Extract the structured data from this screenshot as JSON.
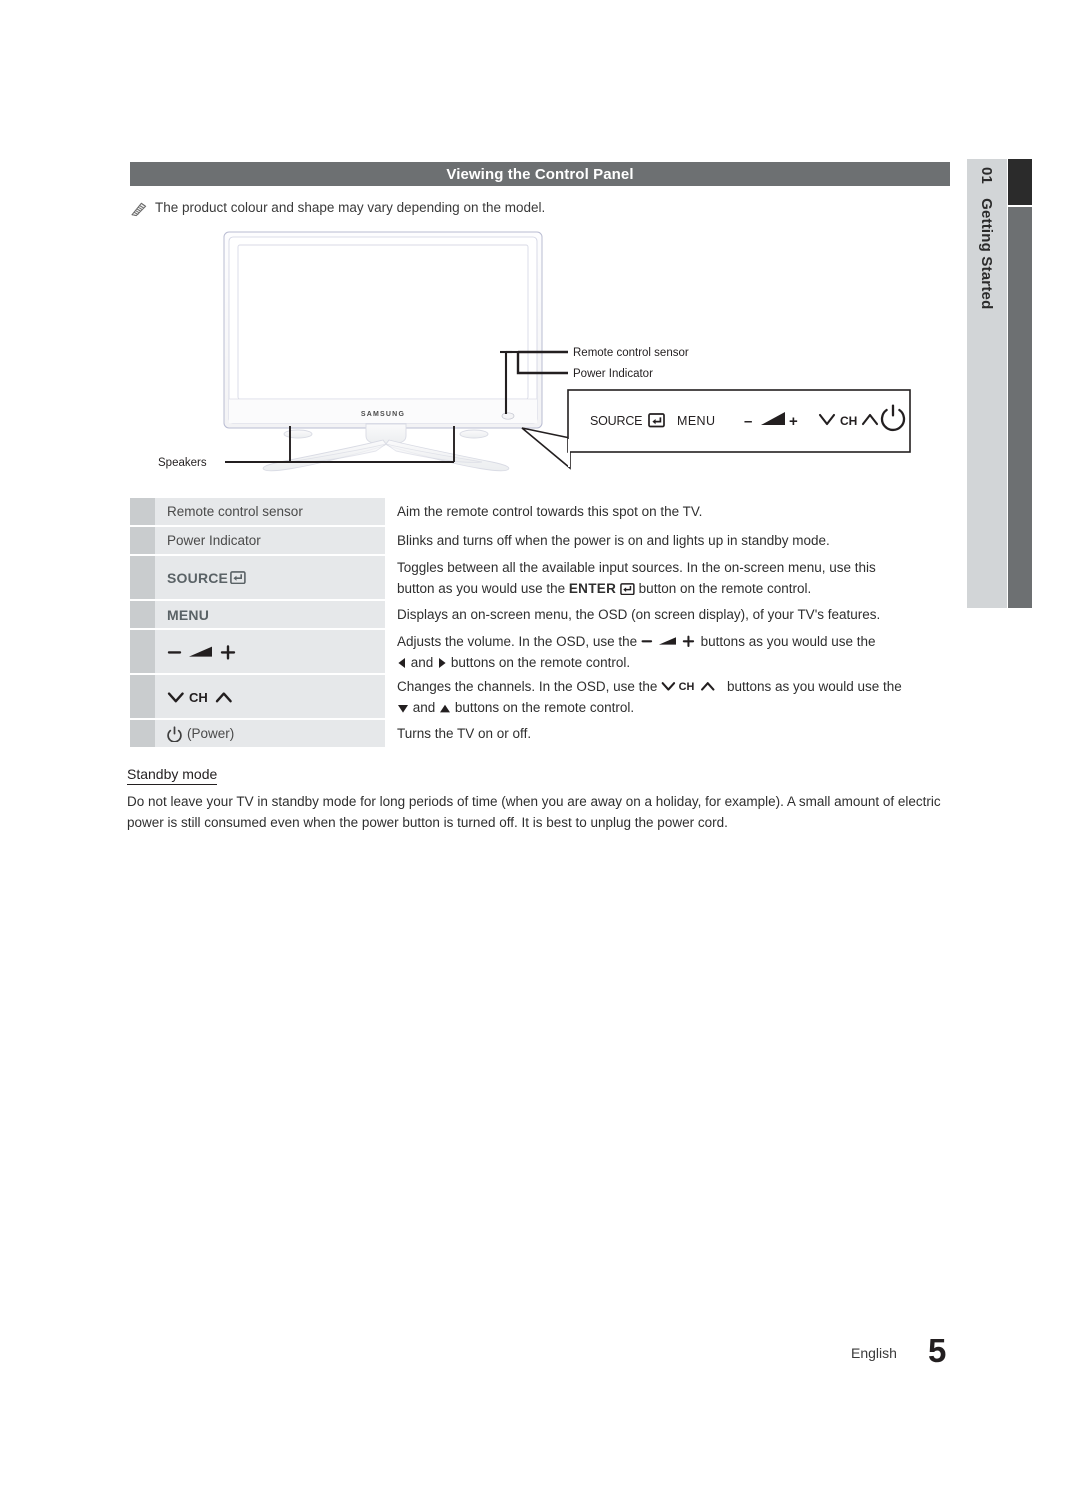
{
  "sidebar": {
    "chapter_number": "01",
    "chapter_title": "Getting Started"
  },
  "header": {
    "title": "Viewing the Control Panel"
  },
  "note": {
    "icon": "pencil-note-icon",
    "text": "The product colour and shape may vary depending on the model."
  },
  "figure": {
    "brand": "SAMSUNG",
    "callouts": {
      "remote_control_sensor": "Remote control sensor",
      "power_indicator": "Power Indicator",
      "speakers": "Speakers"
    },
    "control_panel_buttons": {
      "source": "SOURCE",
      "source_icon": "enter-return-icon",
      "menu": "MENU",
      "volume_minus": "–",
      "volume_icon": "volume-wedge-icon",
      "volume_plus": "+",
      "ch_down_icon": "chevron-down-icon",
      "ch": "CH",
      "ch_up_icon": "chevron-up-icon",
      "power_icon": "power-icon"
    }
  },
  "table": {
    "rows": [
      {
        "key": "Remote control sensor",
        "key_style": "plain",
        "lines": [
          "Aim the remote control towards this spot on the TV."
        ]
      },
      {
        "key": "Power Indicator",
        "key_style": "plain",
        "lines": [
          "Blinks and turns off when the power is on and lights up in standby mode."
        ]
      },
      {
        "key": "SOURCE",
        "key_style": "source",
        "lines": [
          "Toggles between all the available input sources. In the on-screen menu, use this",
          "button as you would use the ENTER ↵ button on the remote control."
        ]
      },
      {
        "key": "MENU",
        "key_style": "bold",
        "lines": [
          "Displays an on-screen menu, the OSD (on screen display), of your TV's features."
        ]
      },
      {
        "key": "VOLUME",
        "key_style": "volume",
        "lines": [
          "Adjusts the volume. In the OSD, use the – ◢ + buttons as you would use the",
          "◀ and ▶ buttons on the remote control."
        ]
      },
      {
        "key": "CH",
        "key_style": "channel",
        "lines": [
          "Changes the channels. In the OSD, use the ∨ CH ∧ buttons as you would use the",
          "▼ and ▲ buttons on the remote control."
        ]
      },
      {
        "key": "(Power)",
        "key_style": "power",
        "lines": [
          "Turns the TV on or off."
        ]
      }
    ]
  },
  "standby": {
    "heading": "Standby mode",
    "paragraph": "Do not leave your TV in standby mode for long periods of time (when you are away on a holiday, for example). A small amount of electric power is still consumed even when the power button is turned off. It is best to unplug the power cord."
  },
  "footer": {
    "language": "English",
    "page_number": "5"
  }
}
